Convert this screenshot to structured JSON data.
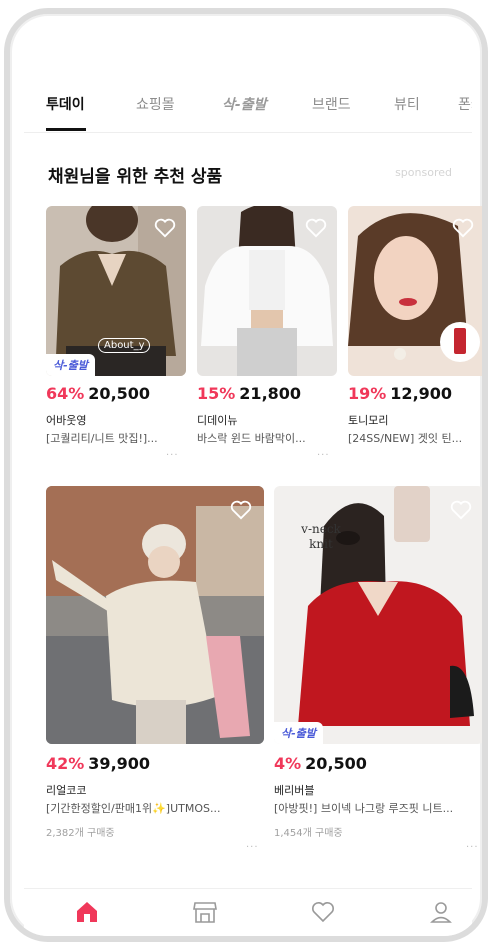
{
  "tabs": [
    "투데이",
    "쇼핑몰",
    "삭-출발",
    "브랜드",
    "뷰티",
    "폰커"
  ],
  "section": {
    "title": "채원님을 위한 추천 상품",
    "sponsored": "sponsored"
  },
  "products": [
    {
      "discount": "64%",
      "price": "20,500",
      "seller": "어바웃영",
      "title": "[고퀄리티/니트 맛집!]...",
      "badge": "삭-출발",
      "photo_label": "About_y"
    },
    {
      "discount": "15%",
      "price": "21,800",
      "seller": "디데이뉴",
      "title": "바스락 윈드 바람막이..."
    },
    {
      "discount": "19%",
      "price": "12,900",
      "seller": "토니모리",
      "title": "[24SS/NEW] 겟잇 틴..."
    },
    {
      "discount": "42%",
      "price": "39,900",
      "seller": "리얼코코",
      "title": "[기간한정할인/판매1위✨]UTMOS...",
      "sold": "2,382개 구매중"
    },
    {
      "discount": "4%",
      "price": "20,500",
      "seller": "베리버블",
      "title": "[아방핏!] 브이넥 나그랑 루즈핏 니트...",
      "sold": "1,454개 구매중",
      "badge": "삭-출발",
      "photo_label": "v-neck knit"
    }
  ],
  "bottom_nav": [
    {
      "label": "홈",
      "icon": "home-icon",
      "active": true
    },
    {
      "label": "마켓",
      "icon": "store-icon",
      "active": false
    },
    {
      "label": "찜",
      "icon": "heart-icon",
      "active": false
    },
    {
      "label": "마이페이지",
      "icon": "person-icon",
      "active": false
    }
  ],
  "colors": {
    "accent": "#f0385a",
    "badge_text": "#4b5bd8"
  }
}
